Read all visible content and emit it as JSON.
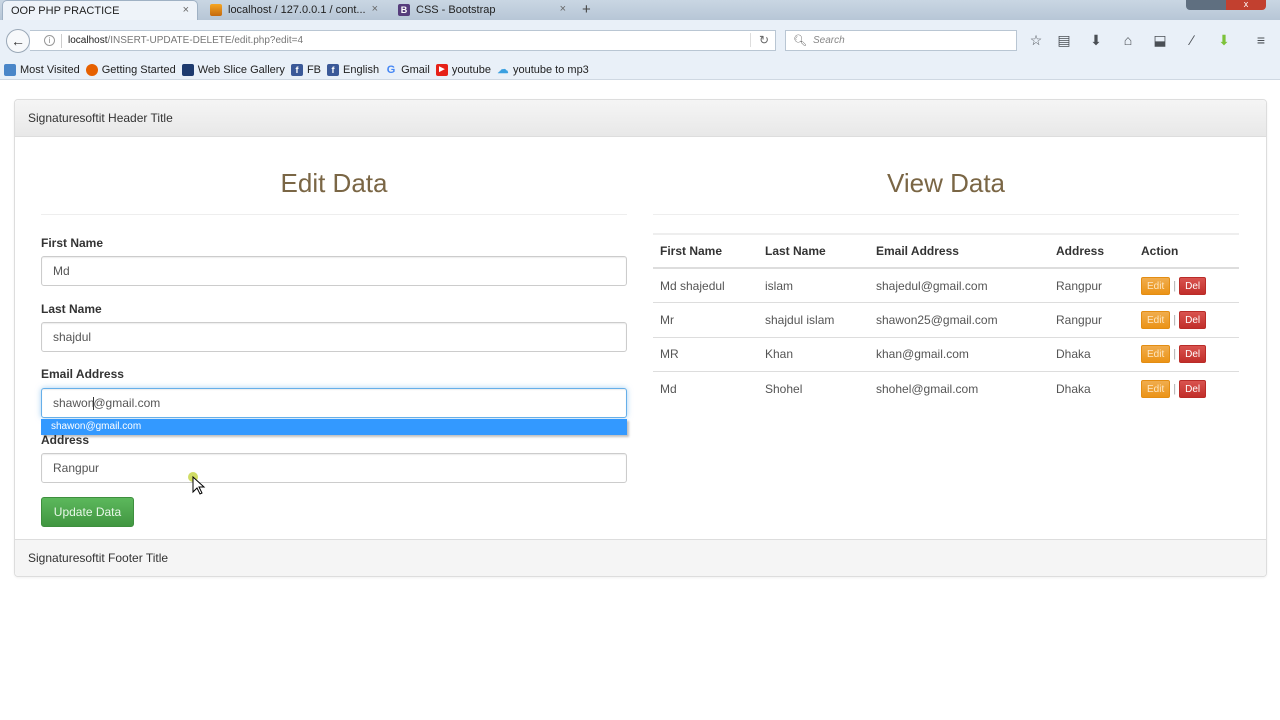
{
  "browser": {
    "tabs": [
      {
        "title": "OOP PHP PRACTICE",
        "active": true
      },
      {
        "title": "localhost / 127.0.0.1 / cont...",
        "active": false
      },
      {
        "title": "CSS - Bootstrap",
        "active": false
      }
    ],
    "new_tab_label": "+",
    "close_glyph": "×",
    "url": {
      "host": "localhost",
      "path": "/INSERT-UPDATE-DELETE/edit.php?edit=4"
    },
    "search_placeholder": "Search",
    "bookmarks": [
      {
        "label": "Most Visited",
        "icon": "most-visited-icon",
        "color": "#4a86c8"
      },
      {
        "label": "Getting Started",
        "icon": "firefox-icon",
        "color": "#e66000"
      },
      {
        "label": "Web Slice Gallery",
        "icon": "web-slice-icon",
        "color": "#1d3a6e"
      },
      {
        "label": "FB",
        "icon": "facebook-icon",
        "color": "#3b5998"
      },
      {
        "label": "English",
        "icon": "facebook-icon",
        "color": "#3b5998"
      },
      {
        "label": "Gmail",
        "icon": "google-icon",
        "color": "#4285f4"
      },
      {
        "label": "youtube",
        "icon": "youtube-icon",
        "color": "#e62117"
      },
      {
        "label": "youtube to mp3",
        "icon": "cloud-download-icon",
        "color": "#3aa0e0"
      }
    ]
  },
  "page": {
    "header_title": "Signaturesoftit Header Title",
    "footer_title": "Signaturesoftit Footer Title",
    "edit": {
      "title": "Edit Data",
      "fields": [
        {
          "label": "First Name",
          "value": "Md"
        },
        {
          "label": "Last Name",
          "value": "shajdul"
        },
        {
          "label": "Email Address",
          "value_before_caret": "shawon",
          "value_after_caret": "@gmail.com"
        },
        {
          "label": "Address",
          "value": "Rangpur"
        }
      ],
      "autocomplete_suggestion": "shawon@gmail.com",
      "submit_label": "Update Data"
    },
    "view": {
      "title": "View Data",
      "columns": [
        "First Name",
        "Last Name",
        "Email Address",
        "Address",
        "Action"
      ],
      "rows": [
        {
          "first": "Md shajedul",
          "last": "islam",
          "email": "shajedul@gmail.com",
          "address": "Rangpur"
        },
        {
          "first": "Mr",
          "last": "shajdul islam",
          "email": "shawon25@gmail.com",
          "address": "Rangpur"
        },
        {
          "first": "MR",
          "last": "Khan",
          "email": "khan@gmail.com",
          "address": "Dhaka"
        },
        {
          "first": "Md",
          "last": "Shohel",
          "email": "shohel@gmail.com",
          "address": "Dhaka"
        }
      ],
      "edit_label": "Edit",
      "delete_label": "Del",
      "separator": "|"
    }
  }
}
